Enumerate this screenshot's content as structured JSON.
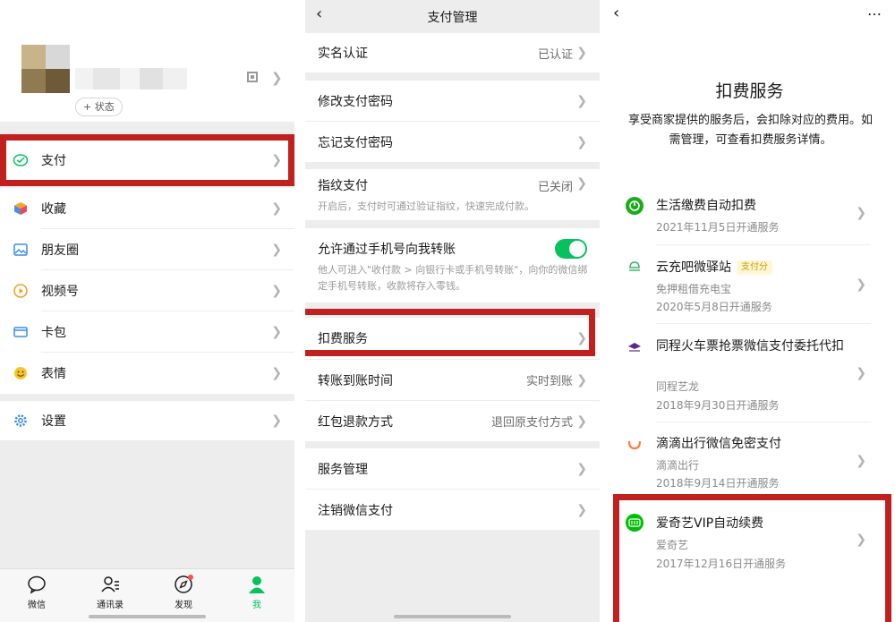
{
  "left_screen": {
    "profile": {
      "status_button": "+ 状态"
    },
    "menu": [
      {
        "label": "支付",
        "icon": "wallet-icon"
      },
      {
        "label": "收藏",
        "icon": "cube-icon"
      },
      {
        "label": "朋友圈",
        "icon": "photo-icon"
      },
      {
        "label": "视频号",
        "icon": "play-icon"
      },
      {
        "label": "卡包",
        "icon": "card-icon"
      },
      {
        "label": "表情",
        "icon": "smile-icon"
      },
      {
        "label": "设置",
        "icon": "gear-icon"
      }
    ],
    "tabs": [
      {
        "label": "微信",
        "icon": "chat-icon"
      },
      {
        "label": "通讯录",
        "icon": "contacts-icon"
      },
      {
        "label": "发现",
        "icon": "compass-icon"
      },
      {
        "label": "我",
        "icon": "person-icon"
      }
    ],
    "accent_color": "#07c160",
    "highlight_color": "#c0201e"
  },
  "middle_screen": {
    "title": "支付管理",
    "rows": {
      "real_name": {
        "label": "实名认证",
        "value": "已认证"
      },
      "change_pwd": {
        "label": "修改支付密码"
      },
      "forgot_pwd": {
        "label": "忘记支付密码"
      },
      "fingerprint": {
        "label": "指纹支付",
        "value": "已关闭",
        "desc": "开启后，支付时可通过验证指纹，快速完成付款。"
      },
      "phone_transfer": {
        "label": "允许通过手机号向我转账",
        "desc": "他人可进入\"收付款 > 向银行卡或手机号转账\"，向你的微信绑定手机号转账，收款将存入零钱。",
        "enabled": true
      },
      "deduct": {
        "label": "扣费服务"
      },
      "transfer_time": {
        "label": "转账到账时间",
        "value": "实时到账"
      },
      "red_packet": {
        "label": "红包退款方式",
        "value": "退回原支付方式"
      },
      "service_mgmt": {
        "label": "服务管理"
      },
      "cancel_pay": {
        "label": "注销微信支付"
      }
    }
  },
  "right_screen": {
    "title": "扣费服务",
    "description": "享受商家提供的服务后，会扣除对应的费用。如需管理，可查看扣费服务详情。",
    "services": [
      {
        "name": "生活缴费自动扣费",
        "merchant": "",
        "date": "2021年11月5日开通服务",
        "logo_color": "#1aad19"
      },
      {
        "name": "云充吧微驿站",
        "badge": "支付分",
        "merchant": "免押租借充电宝",
        "date": "2020年5月8日开通服务",
        "logo_color": "#3cb371"
      },
      {
        "name": "同程火车票抢票微信支付委托代扣",
        "merchant": "同程艺龙",
        "date": "2018年9月30日开通服务",
        "logo_color": "#5b2a86"
      },
      {
        "name": "滴滴出行微信免密支付",
        "merchant": "滴滴出行",
        "date": "2018年9月14日开通服务",
        "logo_color": "#ff7d41"
      },
      {
        "name": "爱奇艺VIP自动续费",
        "merchant": "爱奇艺",
        "date": "2017年12月16日开通服务",
        "logo_color": "#00be06"
      }
    ]
  }
}
